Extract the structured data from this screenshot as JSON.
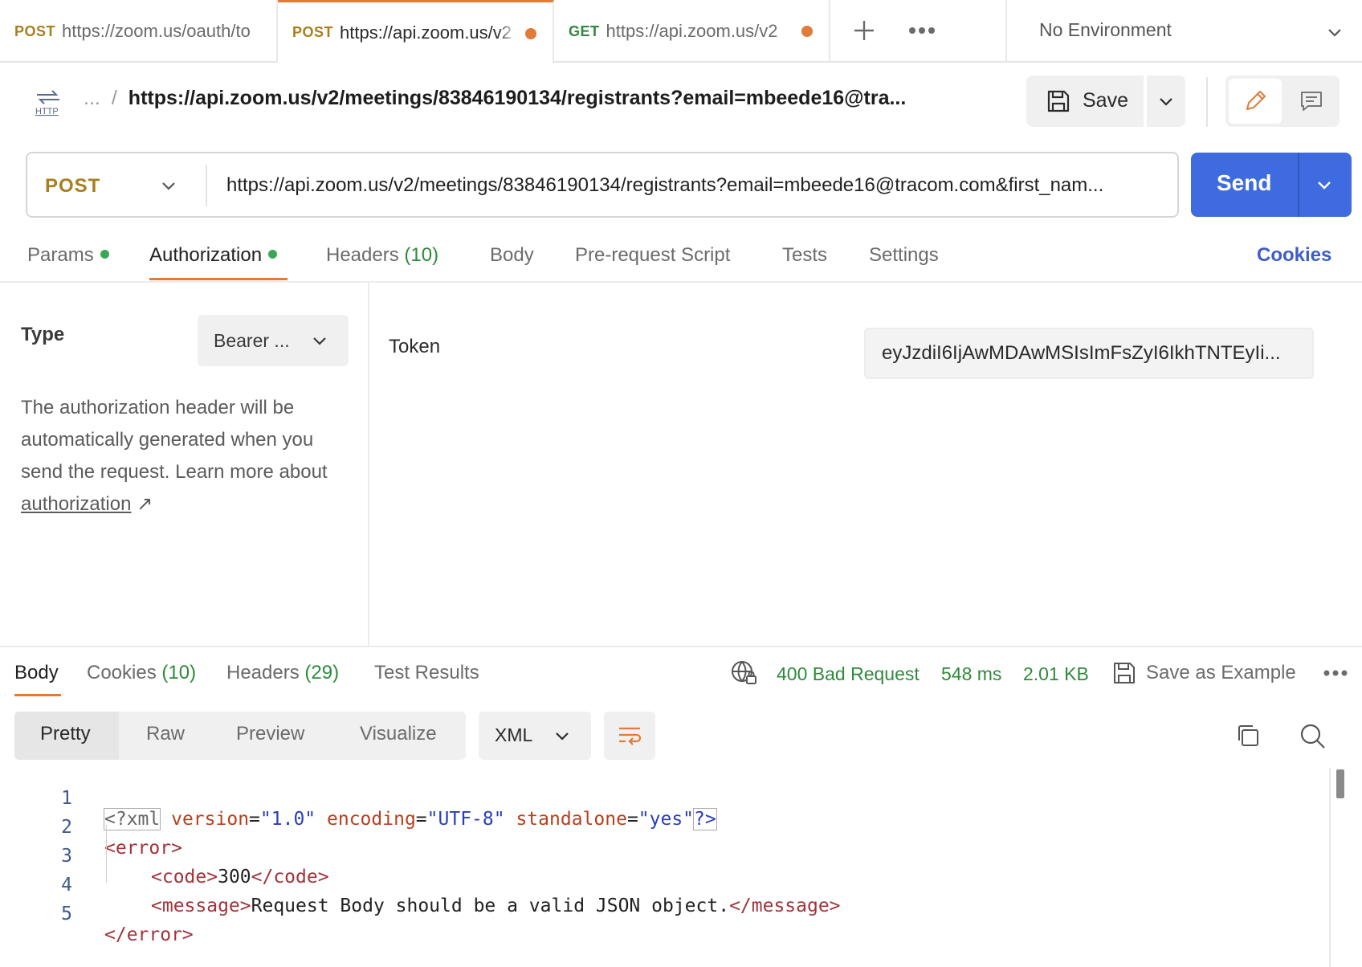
{
  "tabs": [
    {
      "method": "POST",
      "url": "https://zoom.us/oauth/to",
      "active": false,
      "dirty": false
    },
    {
      "method": "POST",
      "url": "https://api.zoom.us/v2",
      "active": true,
      "dirty": true
    },
    {
      "method": "GET",
      "url": "https://api.zoom.us/v2",
      "active": false,
      "dirty": true
    }
  ],
  "environment": "No Environment",
  "breadcrumb": {
    "ellipsis": "...",
    "separator": "/",
    "request_name": "https://api.zoom.us/v2/meetings/83846190134/registrants?email=mbeede16@tra..."
  },
  "toolbar": {
    "save_label": "Save"
  },
  "request": {
    "method": "POST",
    "url": "https://api.zoom.us/v2/meetings/83846190134/registrants?email=mbeede16@tracom.com&first_nam...",
    "send_label": "Send"
  },
  "request_tabs": {
    "params": "Params",
    "authorization": "Authorization",
    "headers": "Headers",
    "headers_count": "(10)",
    "body": "Body",
    "pre_request": "Pre-request Script",
    "tests": "Tests",
    "settings": "Settings",
    "cookies": "Cookies"
  },
  "auth": {
    "type_label": "Type",
    "type_value": "Bearer ...",
    "description": "The authorization header will be automatically generated when you send the request. Learn more about",
    "link": "authorization",
    "link_arrow": "↗",
    "token_label": "Token",
    "token_value": "eyJzdiI6IjAwMDAwMSIsImFsZyI6IkhTNTEyIi..."
  },
  "response_tabs": {
    "body": "Body",
    "cookies": "Cookies",
    "cookies_count": "(10)",
    "headers": "Headers",
    "headers_count": "(29)",
    "test_results": "Test Results"
  },
  "response_status": {
    "status": "400 Bad Request",
    "time": "548 ms",
    "size": "2.01 KB",
    "save_example": "Save as Example"
  },
  "view": {
    "pretty": "Pretty",
    "raw": "Raw",
    "preview": "Preview",
    "visualize": "Visualize",
    "format": "XML"
  },
  "code_lines": {
    "n1": "1",
    "n2": "2",
    "n3": "3",
    "n4": "4",
    "n5": "5",
    "l1_open": "<?xml",
    "l1_a1": "version",
    "l1_v1": "\"1.0\"",
    "l1_a2": "encoding",
    "l1_v2": "\"UTF-8\"",
    "l1_a3": "standalone",
    "l1_v3": "\"yes\"",
    "l1_close": "?>",
    "l2": "<error>",
    "l3_open": "<code>",
    "l3_val": "300",
    "l3_close": "</code>",
    "l4_open": "<message>",
    "l4_val": "Request Body should be a valid JSON object.",
    "l4_close": "</message>",
    "l5": "</error>"
  },
  "colors": {
    "accent": "#e07b39",
    "send": "#3e6be0",
    "post": "#a97e1c",
    "get": "#2f8a3b",
    "status_ok": "#2f8a3b",
    "cookies_link": "#3e5cc9"
  }
}
